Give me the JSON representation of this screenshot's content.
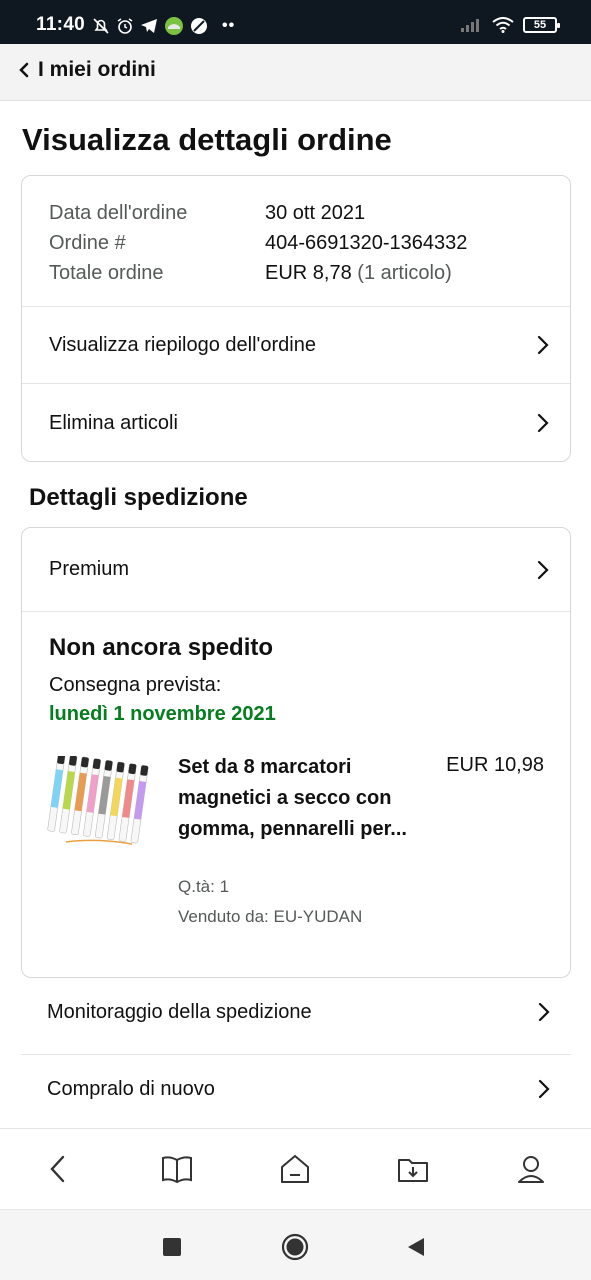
{
  "status_bar": {
    "time": "11:40",
    "battery": "55",
    "icons": [
      "silent-alarm-icon",
      "alarm-icon",
      "telegram-icon",
      "app-icon",
      "vpn-icon",
      "more-dots-icon",
      "signal-icon",
      "wifi-icon",
      "battery-icon"
    ]
  },
  "nav": {
    "back_label": "I miei ordini"
  },
  "page": {
    "title": "Visualizza dettagli ordine"
  },
  "order": {
    "date_label": "Data dell'ordine",
    "date_value": "30 ott 2021",
    "number_label": "Ordine #",
    "number_value": "404-6691320-1364332",
    "total_label": "Totale ordine",
    "total_value": "EUR 8,78",
    "total_count": "(1 articolo)"
  },
  "order_links": [
    {
      "label": "Visualizza riepilogo dell'ordine"
    },
    {
      "label": "Elimina articoli"
    }
  ],
  "shipping": {
    "section_title": "Dettagli spedizione",
    "method": "Premium",
    "status": "Non ancora spedito",
    "delivery_label": "Consegna prevista:",
    "delivery_date": "lunedì 1 novembre 2021",
    "delivery_color": "#067d1e"
  },
  "product": {
    "title": "Set da 8 marcatori magnetici a secco con gomma, pennarelli per...",
    "price": "EUR 10,98",
    "qty": "Q.tà: 1",
    "seller": "Venduto da: EU-YUDAN"
  },
  "actions": [
    {
      "label": "Monitoraggio della spedizione"
    },
    {
      "label": "Compralo di nuovo"
    }
  ],
  "app_bar": [
    "back-icon",
    "book-icon",
    "home-icon",
    "library-icon",
    "profile-icon"
  ],
  "system_nav": [
    "recents-icon",
    "home-button-icon",
    "back-triangle-icon"
  ]
}
